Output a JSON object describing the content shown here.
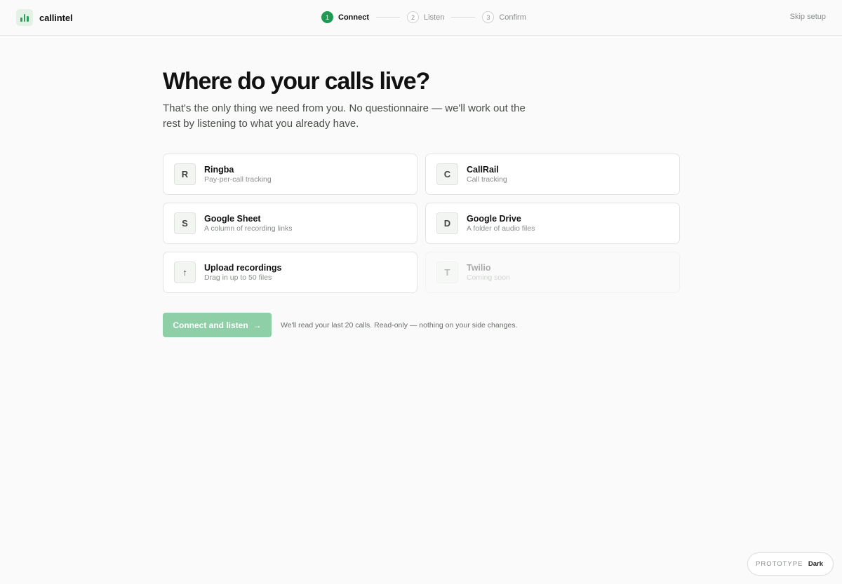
{
  "brand": {
    "name": "callintel"
  },
  "stepper": {
    "steps": [
      {
        "num": "1",
        "label": "Connect"
      },
      {
        "num": "2",
        "label": "Listen"
      },
      {
        "num": "3",
        "label": "Confirm"
      }
    ],
    "active_step": 1
  },
  "header": {
    "skip_label": "Skip setup"
  },
  "main": {
    "title": "Where do your calls live?",
    "subtitle": "That's the only thing we need from you. No questionnaire — we'll work out the rest by listening to what you already have."
  },
  "sources": [
    {
      "badge": "R",
      "title": "Ringba",
      "desc": "Pay-per-call tracking"
    },
    {
      "badge": "C",
      "title": "CallRail",
      "desc": "Call tracking"
    },
    {
      "badge": "S",
      "title": "Google Sheet",
      "desc": "A column of recording links"
    },
    {
      "badge": "D",
      "title": "Google Drive",
      "desc": "A folder of audio files"
    },
    {
      "badge": "↑",
      "title": "Upload recordings",
      "desc": "Drag in up to 50 files"
    },
    {
      "badge": "T",
      "title": "Twilio",
      "desc": "Coming soon"
    }
  ],
  "actions": {
    "connect_label": "Connect and listen",
    "connect_arrow": "→",
    "hint": "We'll read your last 20 calls. Read-only — nothing on your side changes."
  },
  "mode": {
    "label": "PROTOTYPE",
    "value": "Dark"
  },
  "colors": {
    "accent": "#1f9a55",
    "button_disabled": "#8fcfa7"
  }
}
